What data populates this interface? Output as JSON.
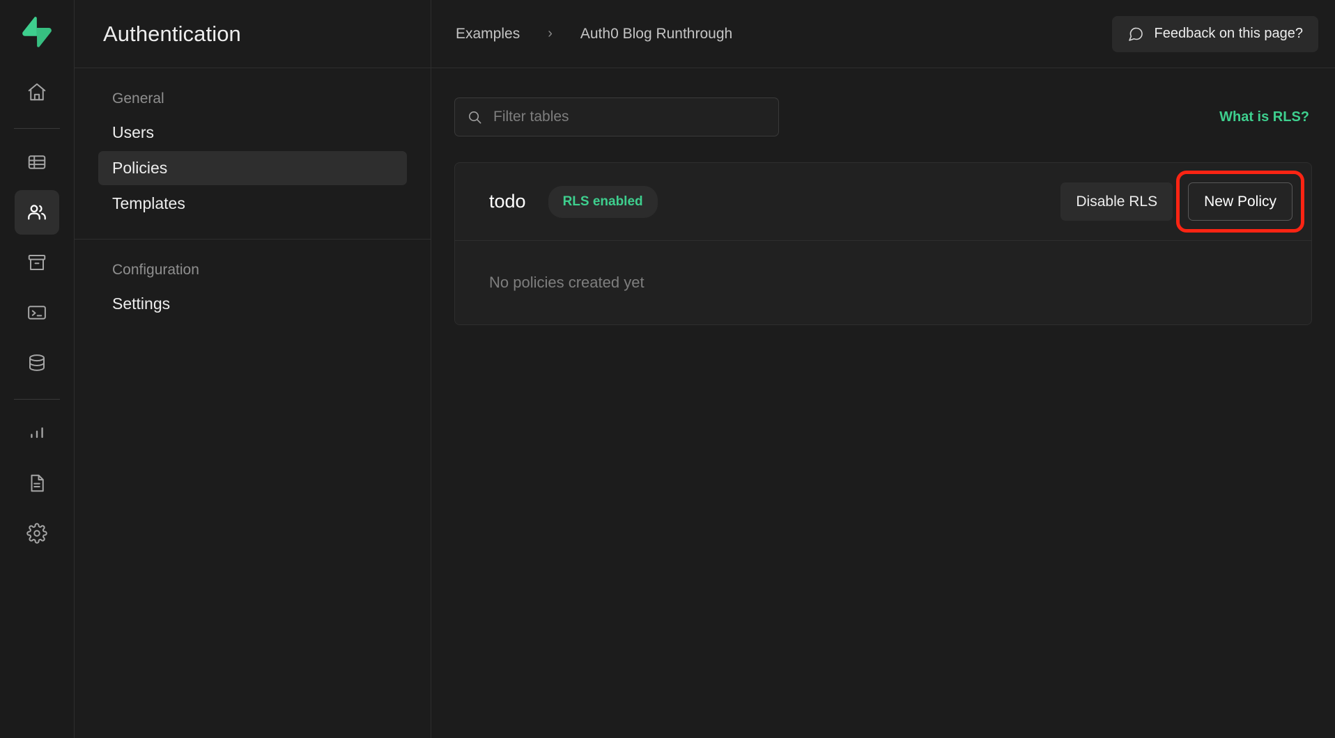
{
  "brand": {
    "logo_icon": "supabase-logo-icon",
    "accent_color": "#3ECF8E"
  },
  "icon_rail": {
    "items": [
      {
        "icon": "home-icon",
        "name": "home",
        "active": false
      },
      {
        "icon": "table-editor-icon",
        "name": "table-editor",
        "active": false
      },
      {
        "icon": "authentication-users-icon",
        "name": "authentication",
        "active": true
      },
      {
        "icon": "storage-box-icon",
        "name": "storage",
        "active": false
      },
      {
        "icon": "sql-editor-terminal-icon",
        "name": "sql-editor",
        "active": false
      },
      {
        "icon": "database-icon",
        "name": "database",
        "active": false
      },
      {
        "icon": "reports-bar-chart-icon",
        "name": "reports",
        "active": false
      },
      {
        "icon": "logs-document-icon",
        "name": "logs",
        "active": false
      },
      {
        "icon": "settings-gear-icon",
        "name": "settings",
        "active": false
      }
    ]
  },
  "sidebar": {
    "title": "Authentication",
    "sections": [
      {
        "label": "General",
        "items": [
          {
            "label": "Users",
            "active": false
          },
          {
            "label": "Policies",
            "active": true
          },
          {
            "label": "Templates",
            "active": false
          }
        ]
      },
      {
        "label": "Configuration",
        "items": [
          {
            "label": "Settings",
            "active": false
          }
        ]
      }
    ]
  },
  "topbar": {
    "breadcrumb": [
      {
        "label": "Examples"
      },
      {
        "label": "Auth0 Blog Runthrough"
      }
    ],
    "separator": "›",
    "feedback_label": "Feedback on this page?",
    "feedback_icon": "speech-bubble-icon"
  },
  "content": {
    "search": {
      "placeholder": "Filter tables",
      "value": "",
      "icon": "search-icon"
    },
    "rls_link_label": "What is RLS?",
    "table_card": {
      "table_name": "todo",
      "rls_badge_label": "RLS enabled",
      "disable_rls_label": "Disable RLS",
      "new_policy_label": "New Policy",
      "new_policy_highlighted": true,
      "highlight_color": "#FA2413",
      "empty_state_text": "No policies created yet"
    }
  }
}
